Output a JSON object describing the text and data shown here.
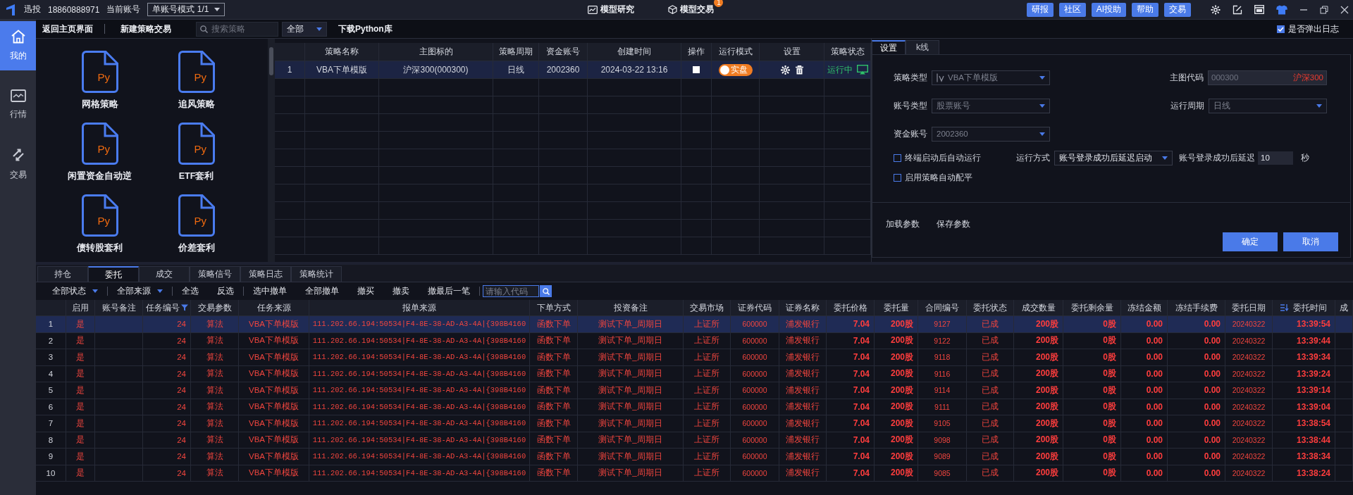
{
  "top_bar": {
    "app_name": "迅投",
    "phone": "18860888971",
    "account_label": "当前账号",
    "account_mode": "单账号模式 1/1",
    "nav": [
      {
        "label": "模型研究"
      },
      {
        "label": "模型交易",
        "badge": "1"
      }
    ],
    "buttons": [
      "研报",
      "社区",
      "AI投助",
      "帮助",
      "交易"
    ]
  },
  "sidebar": {
    "items": [
      {
        "label": "我的",
        "selected": true
      },
      {
        "label": "行情",
        "selected": false
      },
      {
        "label": "交易",
        "selected": false
      }
    ]
  },
  "toolbar": {
    "back": "返回主页界面",
    "new_strategy": "新建策略交易",
    "search": {
      "placeholder": "搜索策略"
    },
    "filter": "全部",
    "download": "下载Python库",
    "show_log": {
      "label": "是否弹出日志",
      "checked": true
    }
  },
  "gallery": {
    "items": [
      {
        "label": "网格策略",
        "file_type": "Py"
      },
      {
        "label": "追风策略",
        "file_type": "Py"
      },
      {
        "label": "闲置资金自动逆",
        "file_type": "Py"
      },
      {
        "label": "ETF套利",
        "file_type": "Py"
      },
      {
        "label": "债转股套利",
        "file_type": "Py"
      },
      {
        "label": "价差套利",
        "file_type": "Py"
      }
    ]
  },
  "strategy_table": {
    "columns": [
      "策略名称",
      "主图标的",
      "策略周期",
      "资金账号",
      "创建时间",
      "操作",
      "运行模式",
      "设置",
      "策略状态"
    ],
    "rows": [
      {
        "index": "1",
        "name": "VBA下单模版",
        "main_symbol": "沪深300(000300)",
        "period": "日线",
        "account": "2002360",
        "created": "2024-03-22 13:16",
        "mode": {
          "label": "实盘",
          "on": true
        },
        "status": "运行中",
        "selected": true
      }
    ]
  },
  "settings": {
    "tabs": [
      {
        "label": "设置",
        "selected": true
      },
      {
        "label": "k线",
        "selected": false
      }
    ],
    "strategy_type": {
      "label": "策略类型",
      "value": "VBA下单模版"
    },
    "main_code": {
      "label": "主图代码",
      "value": "000300",
      "name": "沪深300"
    },
    "account_type": {
      "label": "账号类型",
      "value": "股票账号"
    },
    "run_period": {
      "label": "运行周期",
      "value": "日线"
    },
    "fund_account": {
      "label": "资金账号",
      "value": "2002360"
    },
    "auto_run": {
      "label": "终端启动后自动运行",
      "checked": false
    },
    "run_mode": {
      "label": "运行方式",
      "value": "账号登录成功后延迟启动"
    },
    "delay": {
      "label": "账号登录成功后延迟",
      "value": "10",
      "unit": "秒"
    },
    "auto_balance": {
      "label": "启用策略自动配平",
      "checked": false
    },
    "actions": [
      "加载参数",
      "保存参数"
    ],
    "buttons": [
      "确定",
      "取消"
    ]
  },
  "orders": {
    "tabs": [
      {
        "label": "持仓",
        "selected": false
      },
      {
        "label": "委托",
        "selected": true
      },
      {
        "label": "成交",
        "selected": false
      },
      {
        "label": "策略信号",
        "selected": false
      },
      {
        "label": "策略日志",
        "selected": false
      },
      {
        "label": "策略统计",
        "selected": false
      }
    ],
    "toolbar": [
      {
        "label": "全部状态",
        "kind": "dropdown"
      },
      {
        "label": "全部来源",
        "kind": "dropdown"
      },
      {
        "label": "全选",
        "kind": "button"
      },
      {
        "label": "反选",
        "kind": "button"
      },
      {
        "label": "选中撤单",
        "kind": "button"
      },
      {
        "label": "全部撤单",
        "kind": "button"
      },
      {
        "label": "撤买",
        "kind": "button"
      },
      {
        "label": "撤卖",
        "kind": "button"
      },
      {
        "label": "撤最后一笔",
        "kind": "button"
      }
    ],
    "search": {
      "placeholder": "请输入代码"
    },
    "columns": [
      "启用",
      "账号备注",
      "任务编号",
      "交易参数",
      "任务来源",
      "报单来源",
      "下单方式",
      "投资备注",
      "交易市场",
      "证券代码",
      "证券名称",
      "委托价格",
      "委托量",
      "合同编号",
      "委托状态",
      "成交数量",
      "委托剩余量",
      "冻结金额",
      "冻结手续费",
      "委托日期",
      "委托时间",
      "成"
    ],
    "rows": [
      {
        "index": "1",
        "selected": true,
        "enabled": "是",
        "task_no": "24",
        "trade_param": "算法",
        "task_source": "VBA下单模版",
        "order_source": "111.202.66.194:50534|F4-8E-38-AD-A3-4A|{398B4160",
        "order_method": "函数下单",
        "note": "测试下单_周期日",
        "market": "上证所",
        "code": "600000",
        "name": "浦发银行",
        "price": "7.04",
        "qty": "200股",
        "contract_no": "9127",
        "status": "已成",
        "filled_qty": "200股",
        "remaining": "0股",
        "frozen_amount": "0.00",
        "frozen_fee": "0.00",
        "date": "20240322",
        "time": "13:39:54"
      },
      {
        "index": "2",
        "selected": false,
        "enabled": "是",
        "task_no": "24",
        "trade_param": "算法",
        "task_source": "VBA下单模版",
        "order_source": "111.202.66.194:50534|F4-8E-38-AD-A3-4A|{398B4160",
        "order_method": "函数下单",
        "note": "测试下单_周期日",
        "market": "上证所",
        "code": "600000",
        "name": "浦发银行",
        "price": "7.04",
        "qty": "200股",
        "contract_no": "9122",
        "status": "已成",
        "filled_qty": "200股",
        "remaining": "0股",
        "frozen_amount": "0.00",
        "frozen_fee": "0.00",
        "date": "20240322",
        "time": "13:39:44"
      },
      {
        "index": "3",
        "selected": false,
        "enabled": "是",
        "task_no": "24",
        "trade_param": "算法",
        "task_source": "VBA下单模版",
        "order_source": "111.202.66.194:50534|F4-8E-38-AD-A3-4A|{398B4160",
        "order_method": "函数下单",
        "note": "测试下单_周期日",
        "market": "上证所",
        "code": "600000",
        "name": "浦发银行",
        "price": "7.04",
        "qty": "200股",
        "contract_no": "9118",
        "status": "已成",
        "filled_qty": "200股",
        "remaining": "0股",
        "frozen_amount": "0.00",
        "frozen_fee": "0.00",
        "date": "20240322",
        "time": "13:39:34"
      },
      {
        "index": "4",
        "selected": false,
        "enabled": "是",
        "task_no": "24",
        "trade_param": "算法",
        "task_source": "VBA下单模版",
        "order_source": "111.202.66.194:50534|F4-8E-38-AD-A3-4A|{398B4160",
        "order_method": "函数下单",
        "note": "测试下单_周期日",
        "market": "上证所",
        "code": "600000",
        "name": "浦发银行",
        "price": "7.04",
        "qty": "200股",
        "contract_no": "9116",
        "status": "已成",
        "filled_qty": "200股",
        "remaining": "0股",
        "frozen_amount": "0.00",
        "frozen_fee": "0.00",
        "date": "20240322",
        "time": "13:39:24"
      },
      {
        "index": "5",
        "selected": false,
        "enabled": "是",
        "task_no": "24",
        "trade_param": "算法",
        "task_source": "VBA下单模版",
        "order_source": "111.202.66.194:50534|F4-8E-38-AD-A3-4A|{398B4160",
        "order_method": "函数下单",
        "note": "测试下单_周期日",
        "market": "上证所",
        "code": "600000",
        "name": "浦发银行",
        "price": "7.04",
        "qty": "200股",
        "contract_no": "9114",
        "status": "已成",
        "filled_qty": "200股",
        "remaining": "0股",
        "frozen_amount": "0.00",
        "frozen_fee": "0.00",
        "date": "20240322",
        "time": "13:39:14"
      },
      {
        "index": "6",
        "selected": false,
        "enabled": "是",
        "task_no": "24",
        "trade_param": "算法",
        "task_source": "VBA下单模版",
        "order_source": "111.202.66.194:50534|F4-8E-38-AD-A3-4A|{398B4160",
        "order_method": "函数下单",
        "note": "测试下单_周期日",
        "market": "上证所",
        "code": "600000",
        "name": "浦发银行",
        "price": "7.04",
        "qty": "200股",
        "contract_no": "9111",
        "status": "已成",
        "filled_qty": "200股",
        "remaining": "0股",
        "frozen_amount": "0.00",
        "frozen_fee": "0.00",
        "date": "20240322",
        "time": "13:39:04"
      },
      {
        "index": "7",
        "selected": false,
        "enabled": "是",
        "task_no": "24",
        "trade_param": "算法",
        "task_source": "VBA下单模版",
        "order_source": "111.202.66.194:50534|F4-8E-38-AD-A3-4A|{398B4160",
        "order_method": "函数下单",
        "note": "测试下单_周期日",
        "market": "上证所",
        "code": "600000",
        "name": "浦发银行",
        "price": "7.04",
        "qty": "200股",
        "contract_no": "9105",
        "status": "已成",
        "filled_qty": "200股",
        "remaining": "0股",
        "frozen_amount": "0.00",
        "frozen_fee": "0.00",
        "date": "20240322",
        "time": "13:38:54"
      },
      {
        "index": "8",
        "selected": false,
        "enabled": "是",
        "task_no": "24",
        "trade_param": "算法",
        "task_source": "VBA下单模版",
        "order_source": "111.202.66.194:50534|F4-8E-38-AD-A3-4A|{398B4160",
        "order_method": "函数下单",
        "note": "测试下单_周期日",
        "market": "上证所",
        "code": "600000",
        "name": "浦发银行",
        "price": "7.04",
        "qty": "200股",
        "contract_no": "9098",
        "status": "已成",
        "filled_qty": "200股",
        "remaining": "0股",
        "frozen_amount": "0.00",
        "frozen_fee": "0.00",
        "date": "20240322",
        "time": "13:38:44"
      },
      {
        "index": "9",
        "selected": false,
        "enabled": "是",
        "task_no": "24",
        "trade_param": "算法",
        "task_source": "VBA下单模版",
        "order_source": "111.202.66.194:50534|F4-8E-38-AD-A3-4A|{398B4160",
        "order_method": "函数下单",
        "note": "测试下单_周期日",
        "market": "上证所",
        "code": "600000",
        "name": "浦发银行",
        "price": "7.04",
        "qty": "200股",
        "contract_no": "9089",
        "status": "已成",
        "filled_qty": "200股",
        "remaining": "0股",
        "frozen_amount": "0.00",
        "frozen_fee": "0.00",
        "date": "20240322",
        "time": "13:38:34"
      },
      {
        "index": "10",
        "selected": false,
        "enabled": "是",
        "task_no": "24",
        "trade_param": "算法",
        "task_source": "VBA下单模版",
        "order_source": "111.202.66.194:50534|F4-8E-38-AD-A3-4A|{398B4160",
        "order_method": "函数下单",
        "note": "测试下单_周期日",
        "market": "上证所",
        "code": "600000",
        "name": "浦发银行",
        "price": "7.04",
        "qty": "200股",
        "contract_no": "9085",
        "status": "已成",
        "filled_qty": "200股",
        "remaining": "0股",
        "frozen_amount": "0.00",
        "frozen_fee": "0.00",
        "date": "20240322",
        "time": "13:38:24"
      }
    ]
  }
}
